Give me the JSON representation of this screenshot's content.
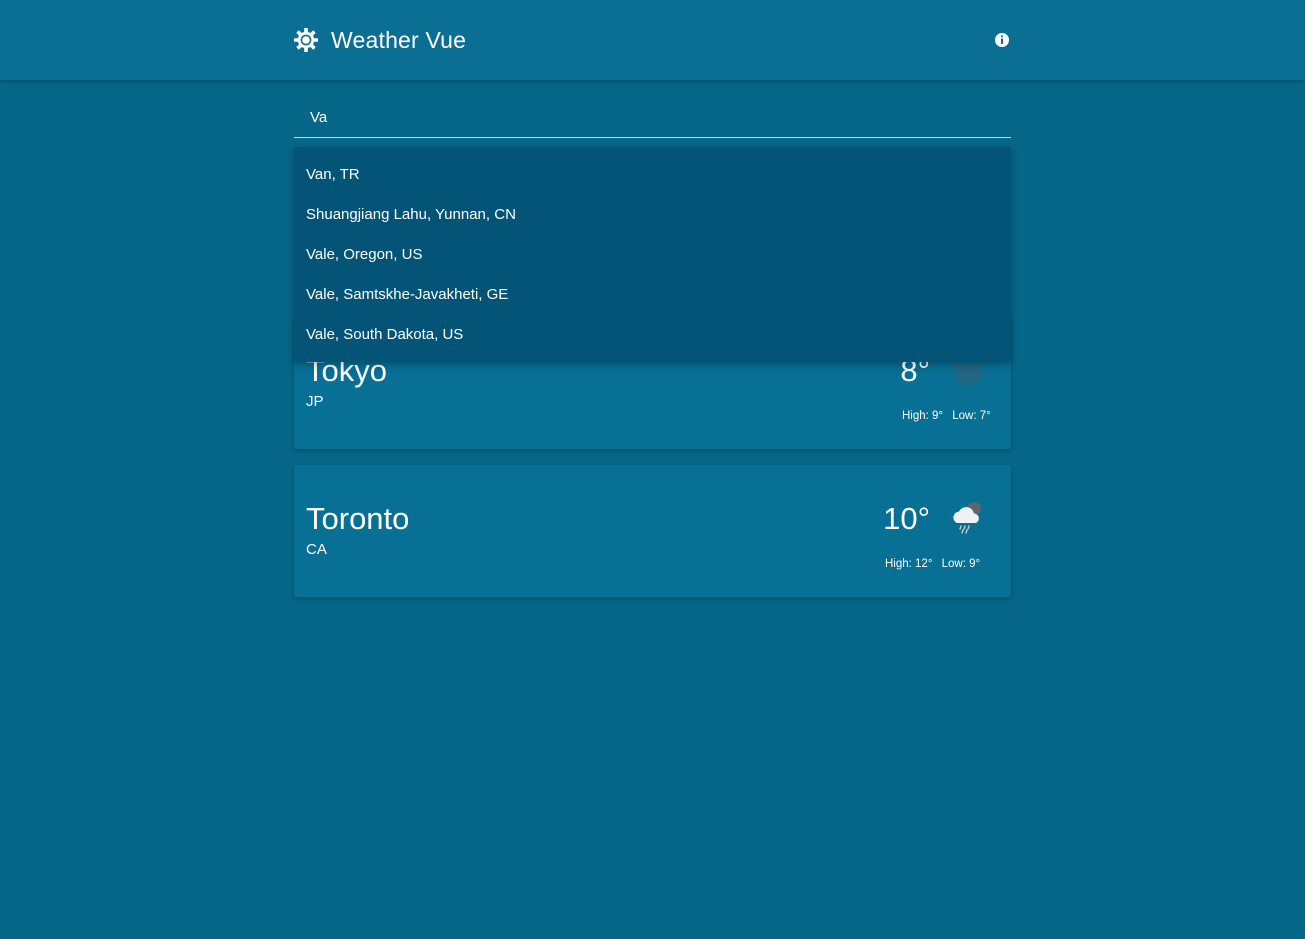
{
  "app": {
    "title": "Weather Vue",
    "logo_icon": "sun-gear-icon",
    "info_icon": "info-icon"
  },
  "search": {
    "value": "Va",
    "placeholder": ""
  },
  "suggestions": [
    "Van, TR",
    "Shuangjiang Lahu, Yunnan, CN",
    "Vale, Oregon, US",
    "Vale, Samtskhe-Javakheti, GE",
    "Vale, South Dakota, US"
  ],
  "cards": [
    {
      "city": "Tokyo",
      "country": "JP",
      "temp": "8°",
      "high": "High: 9°",
      "low": "Low: 7°",
      "icon": "fog-icon"
    },
    {
      "city": "Toronto",
      "country": "CA",
      "temp": "10°",
      "high": "High: 12°",
      "low": "Low: 9°",
      "icon": "rain-cloud-icon"
    }
  ],
  "colors": {
    "background": "#066789",
    "appbar": "#0a6f93",
    "dropdown": "#045478",
    "card": "#086f95",
    "text": "#ffffff"
  }
}
